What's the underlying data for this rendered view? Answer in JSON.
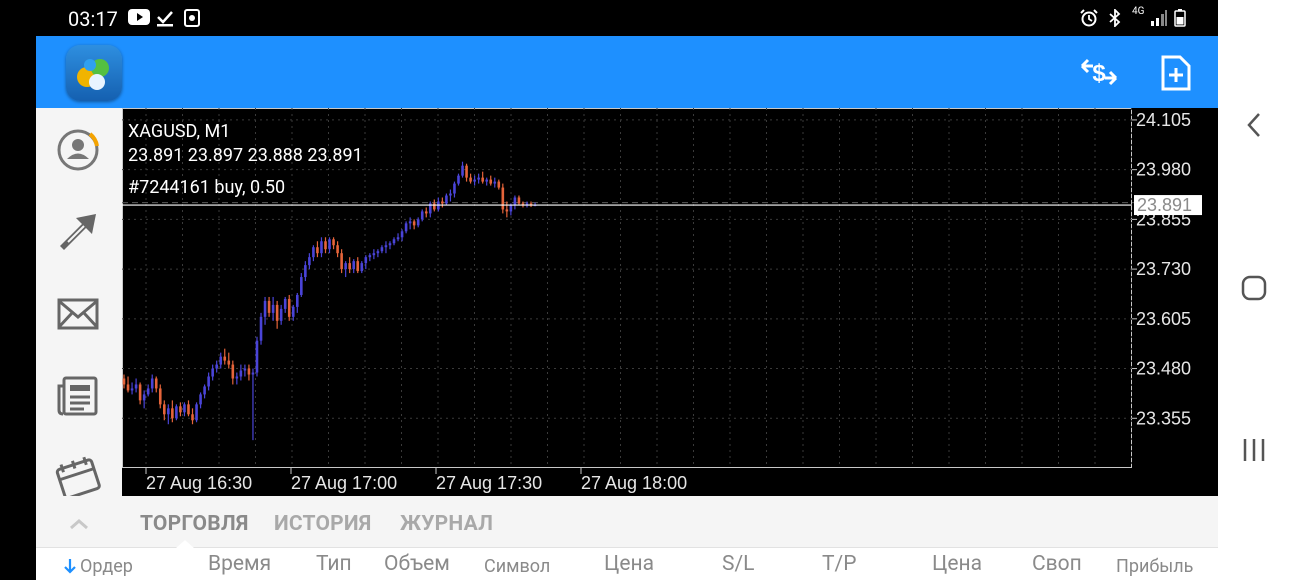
{
  "status_bar": {
    "time": "03:17",
    "left_icons": [
      "youtube-icon",
      "download-done-icon",
      "screenshot-icon"
    ],
    "right_icons": [
      "alarm-icon",
      "bluetooth-icon",
      "4g-icon",
      "signal-icon",
      "battery-icon"
    ],
    "network": "4G"
  },
  "app_bar": {
    "logo": "metatrader-logo",
    "actions": [
      "currency-exchange-icon",
      "new-order-icon"
    ]
  },
  "sidebar": {
    "items": [
      "account-icon",
      "trade-arrows-icon",
      "mail-icon",
      "news-icon",
      "calendar-icon"
    ]
  },
  "chart": {
    "symbol_line": "XAGUSD, M1",
    "ohlc_line": "23.891 23.897 23.888 23.891",
    "order_line": "#7244161 buy, 0.50",
    "current_price_label": "23.891",
    "colors": {
      "bull": "#4a44d8",
      "bear": "#e5643a",
      "grid": "#3a3a3a",
      "price_line": "#ffffff",
      "order_line": "#5a5a5a"
    }
  },
  "chart_data": {
    "type": "candlestick",
    "symbol": "XAGUSD",
    "timeframe": "M1",
    "y_ticks": [
      "24.105",
      "23.980",
      "23.855",
      "23.730",
      "23.605",
      "23.480",
      "23.355"
    ],
    "y_tick_values": [
      24.105,
      23.98,
      23.855,
      23.73,
      23.605,
      23.48,
      23.355
    ],
    "ylim": [
      23.23,
      24.135
    ],
    "x_ticks": [
      "27 Aug 16:30",
      "27 Aug 17:00",
      "27 Aug 17:30",
      "27 Aug 18:00"
    ],
    "x_tick_index": [
      6,
      42,
      78,
      114
    ],
    "current_price": 23.891,
    "order_price": 23.897,
    "grid": true,
    "candles": [
      [
        23.455,
        23.465,
        23.43,
        23.44
      ],
      [
        23.44,
        23.46,
        23.42,
        23.425
      ],
      [
        23.425,
        23.445,
        23.415,
        23.43
      ],
      [
        23.43,
        23.455,
        23.42,
        23.44
      ],
      [
        23.44,
        23.445,
        23.39,
        23.4
      ],
      [
        23.4,
        23.425,
        23.38,
        23.415
      ],
      [
        23.415,
        23.44,
        23.41,
        23.43
      ],
      [
        23.43,
        23.465,
        23.42,
        23.455
      ],
      [
        23.455,
        23.46,
        23.42,
        23.43
      ],
      [
        23.43,
        23.44,
        23.38,
        23.39
      ],
      [
        23.39,
        23.4,
        23.35,
        23.365
      ],
      [
        23.365,
        23.39,
        23.34,
        23.38
      ],
      [
        23.38,
        23.4,
        23.345,
        23.355
      ],
      [
        23.355,
        23.39,
        23.35,
        23.385
      ],
      [
        23.385,
        23.395,
        23.36,
        23.37
      ],
      [
        23.37,
        23.395,
        23.36,
        23.39
      ],
      [
        23.39,
        23.4,
        23.36,
        23.365
      ],
      [
        23.365,
        23.38,
        23.34,
        23.35
      ],
      [
        23.35,
        23.395,
        23.345,
        23.39
      ],
      [
        23.39,
        23.42,
        23.38,
        23.415
      ],
      [
        23.415,
        23.44,
        23.405,
        23.435
      ],
      [
        23.435,
        23.47,
        23.425,
        23.46
      ],
      [
        23.46,
        23.49,
        23.45,
        23.48
      ],
      [
        23.48,
        23.5,
        23.47,
        23.49
      ],
      [
        23.49,
        23.52,
        23.48,
        23.51
      ],
      [
        23.51,
        23.53,
        23.49,
        23.5
      ],
      [
        23.5,
        23.52,
        23.48,
        23.49
      ],
      [
        23.49,
        23.5,
        23.44,
        23.455
      ],
      [
        23.455,
        23.47,
        23.44,
        23.46
      ],
      [
        23.46,
        23.49,
        23.45,
        23.475
      ],
      [
        23.475,
        23.49,
        23.46,
        23.48
      ],
      [
        23.48,
        23.49,
        23.45,
        23.465
      ],
      [
        23.465,
        23.48,
        23.3,
        23.47
      ],
      [
        23.47,
        23.56,
        23.46,
        23.55
      ],
      [
        23.55,
        23.62,
        23.54,
        23.61
      ],
      [
        23.61,
        23.66,
        23.59,
        23.65
      ],
      [
        23.65,
        23.66,
        23.61,
        23.62
      ],
      [
        23.62,
        23.66,
        23.6,
        23.64
      ],
      [
        23.64,
        23.65,
        23.58,
        23.6
      ],
      [
        23.6,
        23.64,
        23.59,
        23.63
      ],
      [
        23.63,
        23.66,
        23.62,
        23.655
      ],
      [
        23.655,
        23.665,
        23.6,
        23.61
      ],
      [
        23.61,
        23.64,
        23.6,
        23.635
      ],
      [
        23.635,
        23.67,
        23.62,
        23.665
      ],
      [
        23.665,
        23.72,
        23.66,
        23.71
      ],
      [
        23.71,
        23.75,
        23.7,
        23.74
      ],
      [
        23.74,
        23.77,
        23.73,
        23.76
      ],
      [
        23.76,
        23.79,
        23.75,
        23.785
      ],
      [
        23.785,
        23.8,
        23.76,
        23.77
      ],
      [
        23.77,
        23.81,
        23.76,
        23.8
      ],
      [
        23.8,
        23.81,
        23.77,
        23.78
      ],
      [
        23.78,
        23.81,
        23.77,
        23.805
      ],
      [
        23.805,
        23.81,
        23.78,
        23.79
      ],
      [
        23.79,
        23.8,
        23.76,
        23.77
      ],
      [
        23.77,
        23.78,
        23.72,
        23.73
      ],
      [
        23.73,
        23.75,
        23.71,
        23.745
      ],
      [
        23.745,
        23.76,
        23.72,
        23.73
      ],
      [
        23.73,
        23.755,
        23.72,
        23.75
      ],
      [
        23.75,
        23.76,
        23.72,
        23.725
      ],
      [
        23.725,
        23.75,
        23.72,
        23.745
      ],
      [
        23.745,
        23.765,
        23.73,
        23.76
      ],
      [
        23.76,
        23.77,
        23.75,
        23.765
      ],
      [
        23.765,
        23.78,
        23.755,
        23.77
      ],
      [
        23.77,
        23.78,
        23.76,
        23.775
      ],
      [
        23.775,
        23.79,
        23.77,
        23.785
      ],
      [
        23.785,
        23.8,
        23.77,
        23.79
      ],
      [
        23.79,
        23.8,
        23.78,
        23.795
      ],
      [
        23.795,
        23.81,
        23.79,
        23.805
      ],
      [
        23.805,
        23.82,
        23.8,
        23.81
      ],
      [
        23.81,
        23.83,
        23.8,
        23.825
      ],
      [
        23.825,
        23.85,
        23.82,
        23.845
      ],
      [
        23.845,
        23.86,
        23.83,
        23.85
      ],
      [
        23.85,
        23.855,
        23.83,
        23.84
      ],
      [
        23.84,
        23.86,
        23.835,
        23.855
      ],
      [
        23.855,
        23.88,
        23.85,
        23.875
      ],
      [
        23.875,
        23.885,
        23.86,
        23.87
      ],
      [
        23.87,
        23.9,
        23.86,
        23.895
      ],
      [
        23.895,
        23.905,
        23.875,
        23.88
      ],
      [
        23.88,
        23.91,
        23.875,
        23.9
      ],
      [
        23.9,
        23.91,
        23.885,
        23.895
      ],
      [
        23.895,
        23.92,
        23.89,
        23.915
      ],
      [
        23.915,
        23.93,
        23.9,
        23.92
      ],
      [
        23.92,
        23.95,
        23.91,
        23.945
      ],
      [
        23.945,
        23.97,
        23.94,
        23.965
      ],
      [
        23.965,
        24.0,
        23.96,
        23.99
      ],
      [
        23.99,
        23.995,
        23.95,
        23.96
      ],
      [
        23.96,
        23.97,
        23.945,
        23.95
      ],
      [
        23.95,
        23.965,
        23.94,
        23.955
      ],
      [
        23.955,
        23.97,
        23.945,
        23.96
      ],
      [
        23.96,
        23.975,
        23.945,
        23.95
      ],
      [
        23.95,
        23.96,
        23.94,
        23.955
      ],
      [
        23.955,
        23.965,
        23.94,
        23.945
      ],
      [
        23.945,
        23.96,
        23.935,
        23.95
      ],
      [
        23.95,
        23.955,
        23.93,
        23.935
      ],
      [
        23.935,
        23.945,
        23.87,
        23.88
      ],
      [
        23.88,
        23.9,
        23.86,
        23.875
      ],
      [
        23.875,
        23.895,
        23.865,
        23.89
      ],
      [
        23.89,
        23.915,
        23.88,
        23.91
      ],
      [
        23.91,
        23.915,
        23.89,
        23.895
      ],
      [
        23.895,
        23.9,
        23.885,
        23.89
      ],
      [
        23.89,
        23.9,
        23.885,
        23.895
      ],
      [
        23.895,
        23.9,
        23.886,
        23.89
      ],
      [
        23.89,
        23.897,
        23.888,
        23.891
      ]
    ]
  },
  "bottom_tabs": {
    "collapse_icon": "chevron-up-icon",
    "items": [
      {
        "label": "ТОРГОВЛЯ",
        "active": true
      },
      {
        "label": "ИСТОРИЯ",
        "active": false
      },
      {
        "label": "ЖУРНАЛ",
        "active": false
      }
    ]
  },
  "table_header": {
    "sort_icon": "sort-down-arrow-icon",
    "columns": [
      "Ордер",
      "Время",
      "Тип",
      "Объем",
      "Символ",
      "Цена",
      "S/L",
      "T/P",
      "Цена",
      "Своп",
      "Прибыль"
    ]
  },
  "android_nav": [
    "back-icon",
    "home-icon",
    "recents-icon"
  ]
}
